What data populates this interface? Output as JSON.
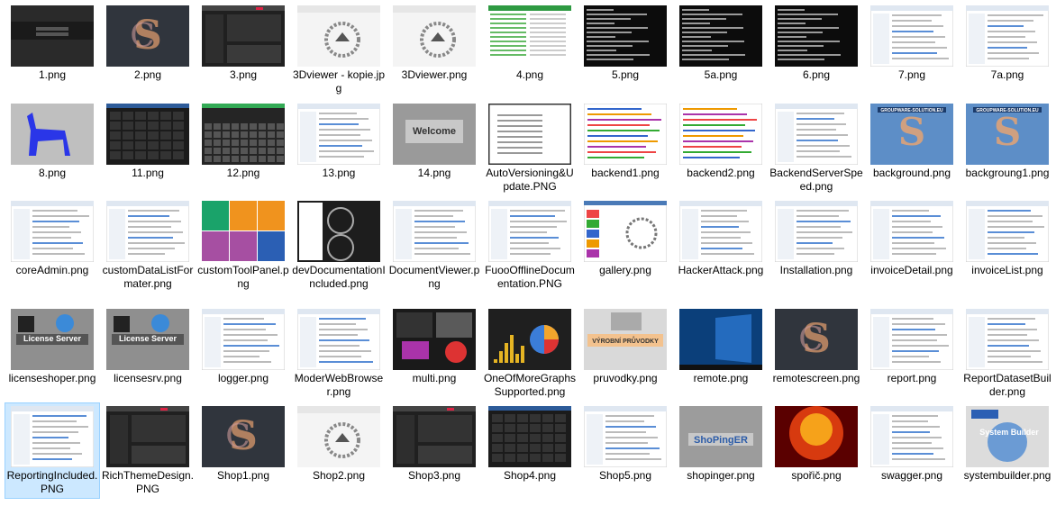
{
  "window": {
    "title": ""
  },
  "files": [
    {
      "name": "1.png",
      "thumb": "dark-login"
    },
    {
      "name": "2.png",
      "thumb": "logo-dark"
    },
    {
      "name": "3.png",
      "thumb": "dark-ui"
    },
    {
      "name": "3Dviewer - kopie.jpg",
      "thumb": "viewer"
    },
    {
      "name": "3Dviewer.png",
      "thumb": "viewer"
    },
    {
      "name": "4.png",
      "thumb": "green-table"
    },
    {
      "name": "5.png",
      "thumb": "console"
    },
    {
      "name": "5a.png",
      "thumb": "console"
    },
    {
      "name": "6.png",
      "thumb": "console"
    },
    {
      "name": "7.png",
      "thumb": "doc-light"
    },
    {
      "name": "7a.png",
      "thumb": "doc-light"
    },
    {
      "name": "8.png",
      "thumb": "lama"
    },
    {
      "name": "11.png",
      "thumb": "dark-grid"
    },
    {
      "name": "12.png",
      "thumb": "dark-keyboard"
    },
    {
      "name": "13.png",
      "thumb": "doc-light"
    },
    {
      "name": "14.png",
      "thumb": "welcome"
    },
    {
      "name": "AutoVersioning&Update.PNG",
      "thumb": "doc-dark-border"
    },
    {
      "name": "backend1.png",
      "thumb": "colorful-doc"
    },
    {
      "name": "backend2.png",
      "thumb": "colorful-doc"
    },
    {
      "name": "BackendServerSpeed.png",
      "thumb": "doc-light"
    },
    {
      "name": "background.png",
      "thumb": "blue-logo"
    },
    {
      "name": "backgroung1.png",
      "thumb": "blue-logo"
    },
    {
      "name": "coreAdmin.png",
      "thumb": "doc-light"
    },
    {
      "name": "customDataListFormater.png",
      "thumb": "doc-light"
    },
    {
      "name": "customToolPanel.png",
      "thumb": "tool-panel"
    },
    {
      "name": "devDocumentationIncluded.png",
      "thumb": "gauges"
    },
    {
      "name": "DocumentViewer.png",
      "thumb": "doc-light"
    },
    {
      "name": "FuooOfflineDocumentation.PNG",
      "thumb": "doc-light"
    },
    {
      "name": "gallery.png",
      "thumb": "gallery"
    },
    {
      "name": "HackerAttack.png",
      "thumb": "doc-light"
    },
    {
      "name": "Installation.png",
      "thumb": "doc-light"
    },
    {
      "name": "invoiceDetail.png",
      "thumb": "doc-light"
    },
    {
      "name": "invoiceList.png",
      "thumb": "doc-light"
    },
    {
      "name": "licenseshoper.png",
      "thumb": "license"
    },
    {
      "name": "licensesrv.png",
      "thumb": "license"
    },
    {
      "name": "logger.png",
      "thumb": "doc-light"
    },
    {
      "name": "ModerWebBrowser.png",
      "thumb": "doc-light"
    },
    {
      "name": "multi.png",
      "thumb": "multi"
    },
    {
      "name": "OneOfMoreGraphsSupported.png",
      "thumb": "graphs"
    },
    {
      "name": "pruvodky.png",
      "thumb": "pruvodky"
    },
    {
      "name": "remote.png",
      "thumb": "windows-desktop"
    },
    {
      "name": "remotescreen.png",
      "thumb": "logo-dark"
    },
    {
      "name": "report.png",
      "thumb": "doc-light"
    },
    {
      "name": "ReportDatasetBuilder.png",
      "thumb": "doc-light"
    },
    {
      "name": "ReportingIncluded.PNG",
      "thumb": "doc-light",
      "selected": true
    },
    {
      "name": "RichThemeDesign.PNG",
      "thumb": "dark-ui"
    },
    {
      "name": "Shop1.png",
      "thumb": "logo-dark"
    },
    {
      "name": "Shop2.png",
      "thumb": "viewer"
    },
    {
      "name": "Shop3.png",
      "thumb": "dark-ui"
    },
    {
      "name": "Shop4.png",
      "thumb": "dark-grid"
    },
    {
      "name": "Shop5.png",
      "thumb": "doc-light"
    },
    {
      "name": "shopinger.png",
      "thumb": "shopinger"
    },
    {
      "name": "spořič.png",
      "thumb": "fire"
    },
    {
      "name": "swagger.png",
      "thumb": "doc-light"
    },
    {
      "name": "systembuilder.png",
      "thumb": "system-builder"
    }
  ],
  "thumb_text": {
    "welcome": "Welcome",
    "license": "License Server",
    "pruvodky": "VÝROBNÍ PRŮVODKY",
    "shopinger": "ShoPingER",
    "system_builder": "System Builder",
    "blue_logo": "GROUPWARE-SOLUTION.EU"
  }
}
